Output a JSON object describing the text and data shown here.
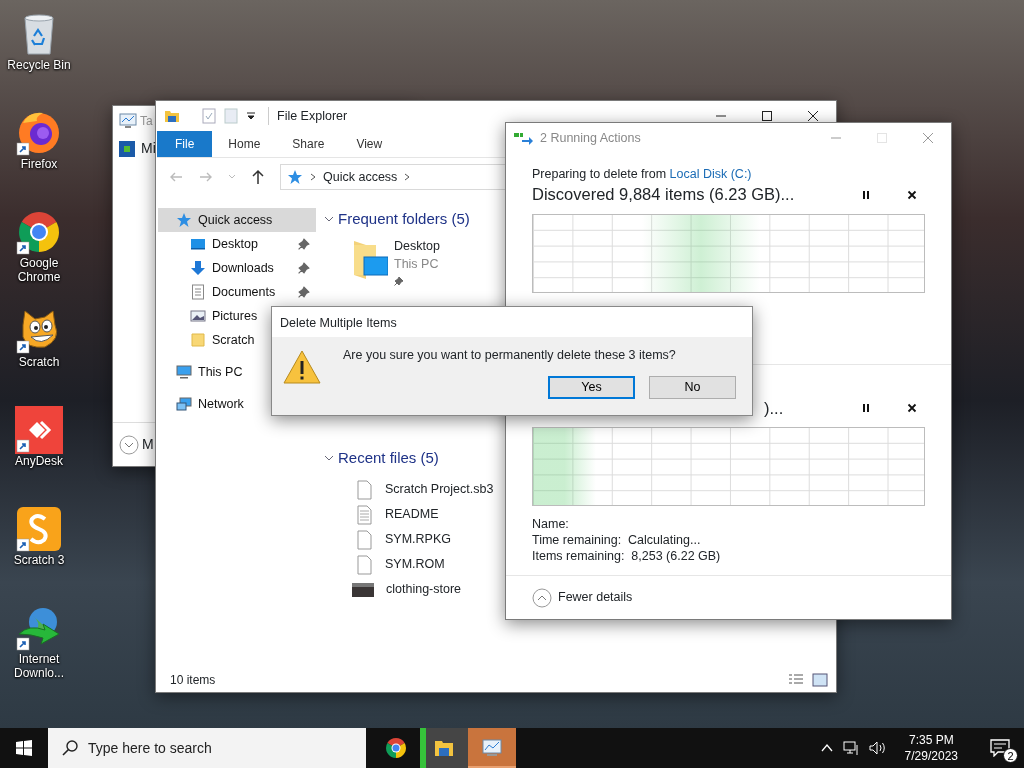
{
  "desktop_icons": [
    {
      "label": "Recycle Bin",
      "kind": "recycle_bin",
      "shortcut": false
    },
    {
      "label": "Firefox",
      "kind": "firefox",
      "shortcut": true
    },
    {
      "label": "Google Chrome",
      "kind": "chrome",
      "shortcut": true
    },
    {
      "label": "Scratch",
      "kind": "scratch",
      "shortcut": true
    },
    {
      "label": "AnyDesk",
      "kind": "anydesk",
      "shortcut": true
    },
    {
      "label": "Scratch 3",
      "kind": "scratch3",
      "shortcut": true
    },
    {
      "label": "Internet Downlo...",
      "kind": "download_manager",
      "shortcut": true
    }
  ],
  "task_manager": {
    "title": "Ta",
    "items": [
      "Mi"
    ],
    "footer": "M"
  },
  "file_explorer": {
    "title": "File Explorer",
    "ribbon_tabs": [
      {
        "label": "File",
        "selected": true
      },
      {
        "label": "Home",
        "selected": false
      },
      {
        "label": "Share",
        "selected": false
      },
      {
        "label": "View",
        "selected": false
      }
    ],
    "breadcrumb": "Quick access",
    "nav": [
      {
        "label": "Quick access",
        "kind": "star",
        "selected": true,
        "children": [
          {
            "label": "Desktop",
            "kind": "desktop",
            "pinned": true,
            "selected": false
          },
          {
            "label": "Downloads",
            "kind": "downloads",
            "pinned": true,
            "selected": false
          },
          {
            "label": "Documents",
            "kind": "documents",
            "pinned": true,
            "selected": false
          },
          {
            "label": "Pictures",
            "kind": "pictures",
            "pinned": false,
            "selected": false
          },
          {
            "label": "Scratch",
            "kind": "folder",
            "pinned": false,
            "selected": false
          }
        ]
      },
      {
        "label": "This PC",
        "kind": "pc",
        "selected": false
      },
      {
        "label": "Network",
        "kind": "network",
        "selected": false
      }
    ],
    "frequent_folders": {
      "heading": "Frequent folders (5)",
      "items": [
        {
          "name": "Desktop",
          "location": "This PC",
          "pinned": true
        }
      ]
    },
    "recent_files": {
      "heading": "Recent files (5)",
      "items": [
        {
          "name": "Scratch Project.sb3",
          "kind": "file"
        },
        {
          "name": "README",
          "kind": "text"
        },
        {
          "name": "SYM.RPKG",
          "kind": "file"
        },
        {
          "name": "SYM.ROM",
          "kind": "file"
        },
        {
          "name": "clothing-store",
          "kind": "image"
        }
      ]
    },
    "status": "10 items"
  },
  "running_actions": {
    "title": "2 Running Actions",
    "operations": [
      {
        "source_text": "Preparing to delete from",
        "source_link": "Local Disk (C:)",
        "heading": "Discovered 9,884 items (6.23 GB)..."
      },
      {
        "heading": ")...",
        "level": 0.08
      }
    ],
    "details": [
      "Name:",
      "Time remaining:  Calculating...",
      "Items remaining:  8,253 (6.22 GB)"
    ],
    "toggle": "Fewer details"
  },
  "dialog": {
    "title": "Delete Multiple Items",
    "message": "Are you sure you want to permanently delete these 3 items?",
    "buttons": [
      {
        "label": "Yes",
        "selected": true
      },
      {
        "label": "No",
        "selected": false
      }
    ]
  },
  "taskbar": {
    "search_placeholder": "Type here to search",
    "apps": [
      {
        "kind": "chrome",
        "open": false,
        "flashing": false
      },
      {
        "kind": "explorer",
        "open": true,
        "flashing": false
      },
      {
        "kind": "taskmgr",
        "open": true,
        "flashing": true
      }
    ],
    "time": "7:35 PM",
    "date": "7/29/2023",
    "notifications": "2"
  }
}
